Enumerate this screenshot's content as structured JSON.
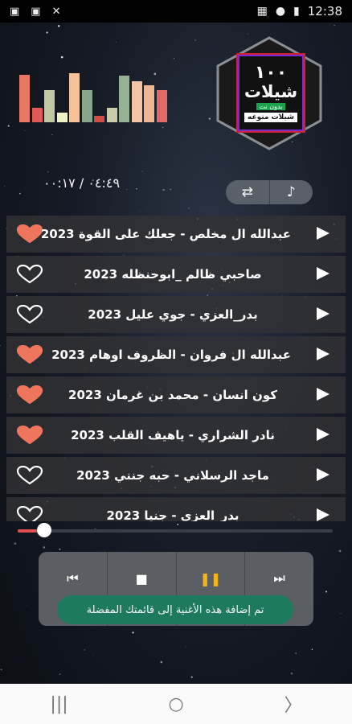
{
  "status_bar": {
    "time": "12:38",
    "left_icons": [
      "gallery-icon",
      "gallery-icon",
      "mute-icon"
    ],
    "right_icons": [
      "image-icon",
      "lock-icon",
      "battery-icon"
    ]
  },
  "equalizer": {
    "bar_levels": [
      0.92,
      0.28,
      0.62,
      0.18,
      0.95,
      0.62,
      0.12,
      0.28,
      0.9,
      0.8,
      0.72,
      0.62
    ],
    "colors": [
      "#e87866",
      "#e05a5a",
      "#c2c7a6",
      "#f1f1c8",
      "#f4c19b",
      "#85a68b",
      "#d04a4a",
      "#c9cca6",
      "#95b093",
      "#f3c5a6",
      "#f0b593",
      "#e16a68"
    ]
  },
  "logo": {
    "number": "١٠٠",
    "main": "شيلات",
    "sub": "بدون نت",
    "bottom": "شيلات منوعه"
  },
  "timer": "٠٤:٤٩ / ٠٠:١٧",
  "controls": {
    "repeat_icon": "repeat-icon",
    "music_icon": "music-note-icon"
  },
  "songs": [
    {
      "title": "عبدالله ال مخلص - جعلك على القوة 2023",
      "favorite": true
    },
    {
      "title": "صاحبي ظالم _ابوحنظله 2023",
      "favorite": false
    },
    {
      "title": "بدر_العزي - جوي عليل 2023",
      "favorite": false
    },
    {
      "title": "عبدالله ال فروان - الظروف اوهام 2023",
      "favorite": true
    },
    {
      "title": "كون انسان - محمد بن غرمان 2023",
      "favorite": true
    },
    {
      "title": "نادر الشراري - ياهيف القلب 2023",
      "favorite": true
    },
    {
      "title": "ماجد الرسلاني - حبه جنني 2023",
      "favorite": false
    },
    {
      "title": "بدر_العزي - جنيا 2023",
      "favorite": false
    }
  ],
  "seek": {
    "progress": 0.06
  },
  "player": {
    "prev_icon": "skip-previous-icon",
    "stop_icon": "stop-icon",
    "pause_icon": "pause-icon",
    "next_icon": "skip-next-icon"
  },
  "toast": "تم إضافة هذه الأغنية إلى قائمتك المفضلة",
  "navbar": {
    "recents": "|||",
    "home": "○",
    "back": "〉"
  },
  "colors": {
    "heart_fill": "#ef765c",
    "accent": "#e05050",
    "toast_bg": "#1e7a5f"
  }
}
